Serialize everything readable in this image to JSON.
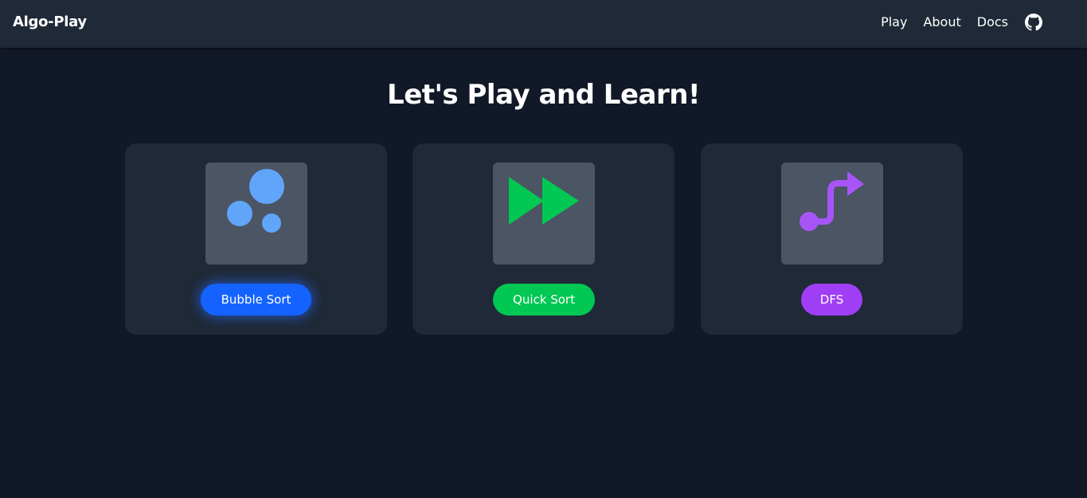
{
  "navbar": {
    "brand": "Algo-Play",
    "links": [
      "Play",
      "About",
      "Docs"
    ],
    "github_icon": "github-icon"
  },
  "heading": "Let's Play and Learn!",
  "cards": [
    {
      "label": "Bubble Sort",
      "icon": "bubbles-icon",
      "icon_color": "#60a5fa",
      "button_color": "#1463ff"
    },
    {
      "label": "Quick Sort",
      "icon": "fast-forward-icon",
      "icon_color": "#00c853",
      "button_color": "#00c853"
    },
    {
      "label": "DFS",
      "icon": "path-arrow-icon",
      "icon_color": "#a855f7",
      "button_color": "#a03ef5"
    }
  ],
  "colors": {
    "background": "#111827",
    "navbar": "#1f2937",
    "card": "#1f2937",
    "icon_box": "#4b5563"
  }
}
